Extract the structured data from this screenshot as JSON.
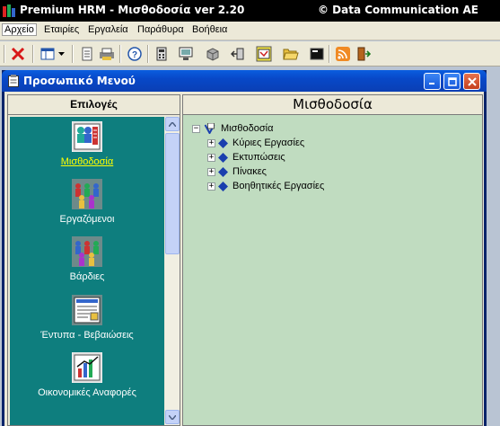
{
  "app": {
    "title": "Premium HRM - Μισθοδοσία ver 2.20",
    "copyright": "© Data Communication AE"
  },
  "menu": [
    "Αρχείο",
    "Εταιρίες",
    "Εργαλεία",
    "Παράθυρα",
    "Βοήθεια"
  ],
  "toolbar": [
    "close-icon",
    "layout-icon",
    "dropdown-arrow-icon",
    "document-icon",
    "printer-icon",
    "help-icon",
    "calculator-icon",
    "monitor-icon",
    "box-icon",
    "exit-door-icon",
    "calendar-icon",
    "folder-open-icon",
    "terminal-icon",
    "rss-icon",
    "logout-icon"
  ],
  "window": {
    "title": "Προσωπικό Μενού"
  },
  "left": {
    "header": "Επιλογές",
    "items": [
      {
        "label": "Μισθοδοσία",
        "icon": "payroll-icon",
        "selected": true
      },
      {
        "label": "Εργαζόμενοι",
        "icon": "employees-icon",
        "selected": false
      },
      {
        "label": "Βάρδιες",
        "icon": "shifts-icon",
        "selected": false
      },
      {
        "label": "Έντυπα - Βεβαιώσεις",
        "icon": "forms-icon",
        "selected": false
      },
      {
        "label": "Οικονομικές Αναφορές",
        "icon": "financial-reports-icon",
        "selected": false
      }
    ]
  },
  "right": {
    "header": "Μισθοδοσία",
    "tree": {
      "root": "Μισθοδοσία",
      "children": [
        "Κύριες Εργασίες",
        "Εκτυπώσεις",
        "Πίνακες",
        "Βοηθητικές Εργασίες"
      ]
    }
  },
  "colors": {
    "teal_panel": "#0e7e7e",
    "tree_bg": "#c0dcc0",
    "selected_label": "#ffff00"
  }
}
